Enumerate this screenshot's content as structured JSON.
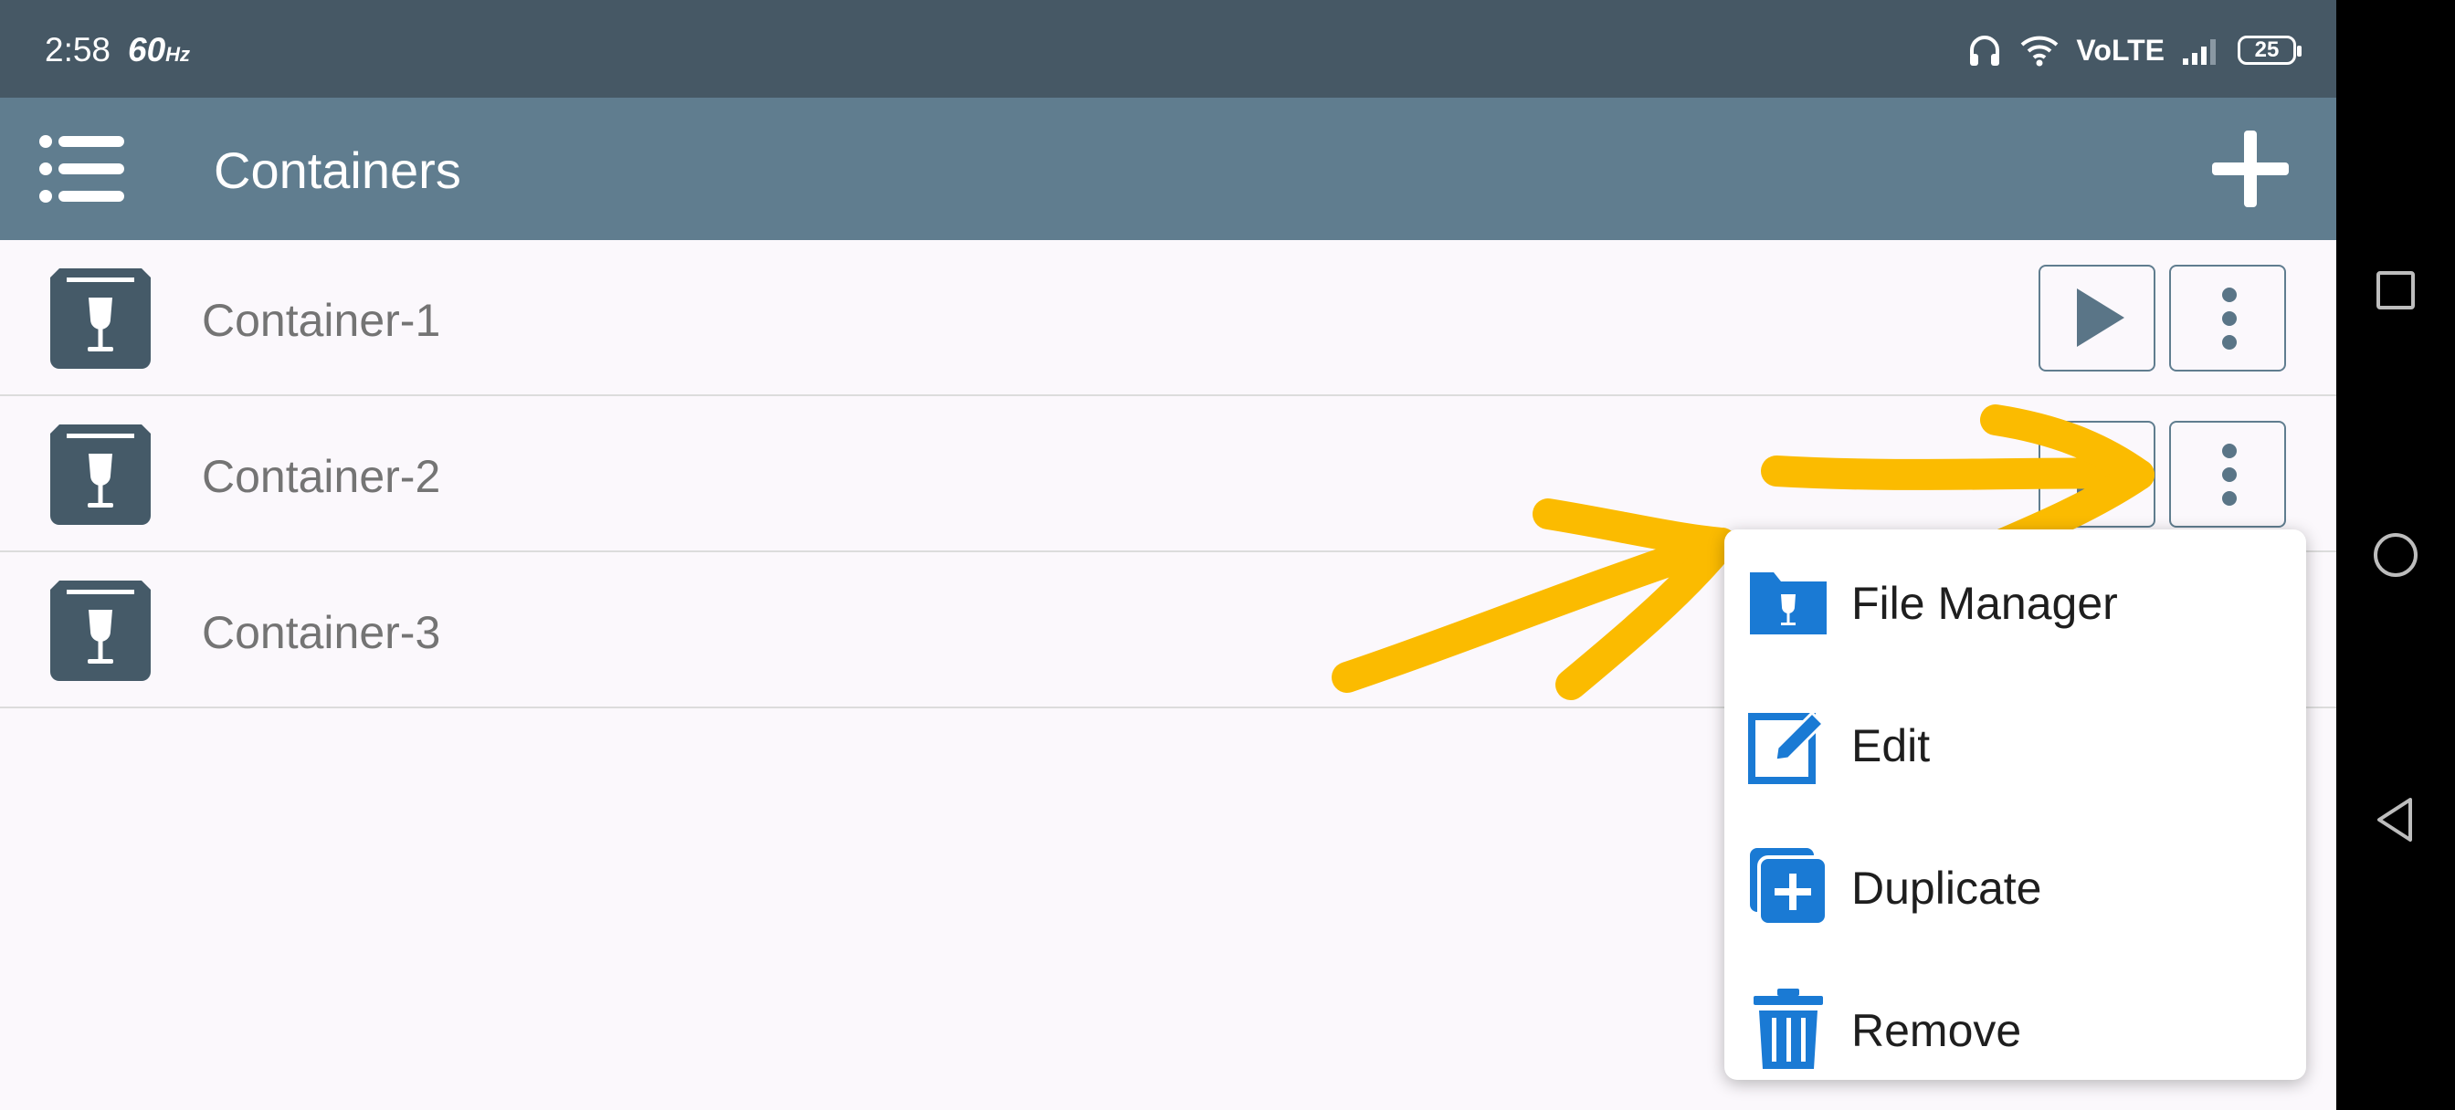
{
  "status_bar": {
    "time": "2:58",
    "refresh_rate": "60",
    "refresh_unit": "Hz",
    "network": "VoLTE",
    "battery": "25"
  },
  "app_bar": {
    "title": "Containers",
    "menu_icon": "list-menu-icon",
    "add_icon": "plus-icon"
  },
  "containers": [
    {
      "name": "Container-1",
      "icon": "wine-glass-box-icon"
    },
    {
      "name": "Container-2",
      "icon": "wine-glass-box-icon"
    },
    {
      "name": "Container-3",
      "icon": "wine-glass-box-icon"
    }
  ],
  "context_menu": {
    "items": [
      {
        "label": "File Manager",
        "icon": "folder-wine-icon"
      },
      {
        "label": "Edit",
        "icon": "edit-icon"
      },
      {
        "label": "Duplicate",
        "icon": "duplicate-icon"
      },
      {
        "label": "Remove",
        "icon": "trash-icon"
      }
    ]
  },
  "colors": {
    "status_bar": "#465865",
    "app_bar": "#607d8f",
    "accent_blue": "#1a7ad4",
    "annotation": "#fbbb00"
  }
}
